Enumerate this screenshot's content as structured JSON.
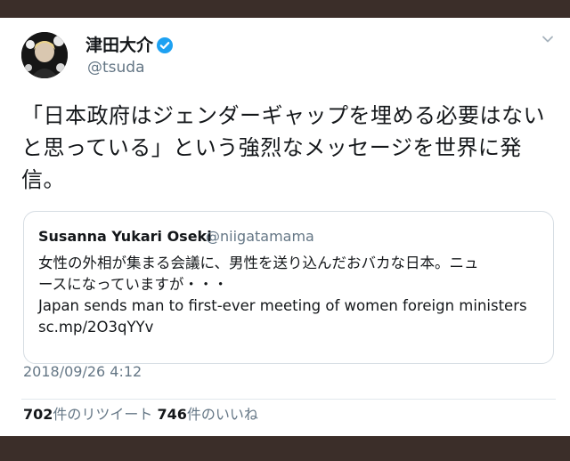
{
  "tweet": {
    "display_name": "津田大介",
    "handle": "@tsuda",
    "lines": [
      "「日本政府はジェンダーギャップを埋める必要はない",
      "と思っている」という強烈なメッセージを世界に発",
      "信。"
    ],
    "timestamp": "2018/09/26 4:12"
  },
  "quoted": {
    "display_name": "Susanna Yukari Oseki",
    "handle": "@niigatamama",
    "lines": [
      "女性の外相が集まる会議に、男性を送り込んだおバカな日本。ニュ",
      "ースになっていますが・・・",
      "Japan sends man to first-ever meeting of women foreign ministers",
      "sc.mp/2O3qYYv"
    ]
  },
  "stats": {
    "retweets_count": "702",
    "retweets_label": "件のリツイート",
    "likes_count": "746",
    "likes_label": "件のいいね"
  },
  "colors": {
    "verified": "#1da1f2",
    "secondary_text": "#657786",
    "frame": "#3b2e29"
  },
  "icons": [
    "verified-icon",
    "chevron-down-icon"
  ]
}
